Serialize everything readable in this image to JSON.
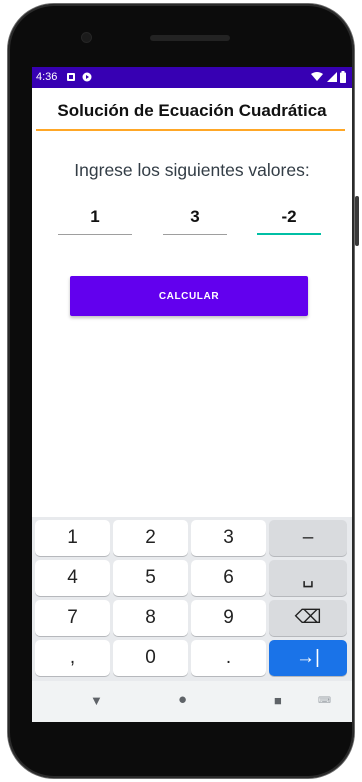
{
  "status_bar": {
    "time": "4:36",
    "background": "#3700b3",
    "icons": [
      "sim-card-icon",
      "google-play-icon",
      "wifi-icon",
      "signal-icon",
      "battery-icon"
    ]
  },
  "app_bar": {
    "title": "Solución de Ecuación Cuadrática",
    "accent": "#ffa726"
  },
  "form": {
    "prompt": "Ingrese los siguientes valores:",
    "fields": [
      {
        "value": "1"
      },
      {
        "value": "3"
      },
      {
        "value": "-2",
        "focused": true
      }
    ],
    "calculate_label": "CALCULAR",
    "button_color": "#6200ee"
  },
  "keyboard": {
    "rows": [
      [
        "1",
        "2",
        "3",
        "–"
      ],
      [
        "4",
        "5",
        "6",
        "␣"
      ],
      [
        "7",
        "8",
        "9",
        "⌫"
      ],
      [
        ",",
        "0",
        ".",
        "→|"
      ]
    ]
  },
  "nav_bar": {
    "back": "▼",
    "home": "●",
    "recents": "■",
    "keyboard_switch": "⌨"
  }
}
